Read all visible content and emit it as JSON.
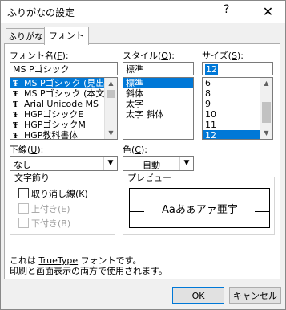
{
  "window": {
    "title": "ふりがなの設定",
    "help": "?",
    "close": "✕"
  },
  "tabs": [
    {
      "label": "ふりがな"
    },
    {
      "label": "フォント"
    }
  ],
  "font": {
    "label": "フォント名(",
    "accel": "F",
    "label_end": "):",
    "value": "MS Pゴシック",
    "items": [
      {
        "name": "MS Pゴシック (見出",
        "selected": true
      },
      {
        "name": "MS Pゴシック (本文"
      },
      {
        "name": "Arial Unicode MS"
      },
      {
        "name": "HGPゴシックE"
      },
      {
        "name": "HGPゴシックM"
      },
      {
        "name": "HGP教科書体"
      }
    ]
  },
  "style": {
    "label": "スタイル(",
    "accel": "O",
    "label_end": "):",
    "value": "標準",
    "items": [
      {
        "name": "標準",
        "selected": true
      },
      {
        "name": "斜体"
      },
      {
        "name": "太字"
      },
      {
        "name": "太字 斜体"
      }
    ]
  },
  "size": {
    "label": "サイズ(",
    "accel": "S",
    "label_end": "):",
    "value": "12",
    "items": [
      {
        "name": "6"
      },
      {
        "name": "8"
      },
      {
        "name": "9"
      },
      {
        "name": "10"
      },
      {
        "name": "11"
      },
      {
        "name": "12",
        "selected": true
      }
    ]
  },
  "underline": {
    "label": "下線(",
    "accel": "U",
    "label_end": "):",
    "value": "なし"
  },
  "color": {
    "label": "色(",
    "accel": "C",
    "label_end": "):",
    "value": "自動"
  },
  "effects": {
    "title": "文字飾り",
    "strike": {
      "label": "取り消し線(",
      "accel": "K",
      "label_end": ")"
    },
    "superscript": {
      "label": "上付き(E)"
    },
    "subscript": {
      "label": "下付き(B)"
    }
  },
  "preview": {
    "title": "プレビュー",
    "text": "Aaあぁアァ亜宇"
  },
  "info": {
    "line1_pre": "これは ",
    "line1_tt": "TrueType",
    "line1_post": " フォントです。",
    "line2": "印刷と画面表示の両方で使用されます。"
  },
  "buttons": {
    "ok": "OK",
    "cancel": "キャンセル"
  },
  "colors": {
    "selection": "#0078d7",
    "accent_border": "#0078d7"
  }
}
